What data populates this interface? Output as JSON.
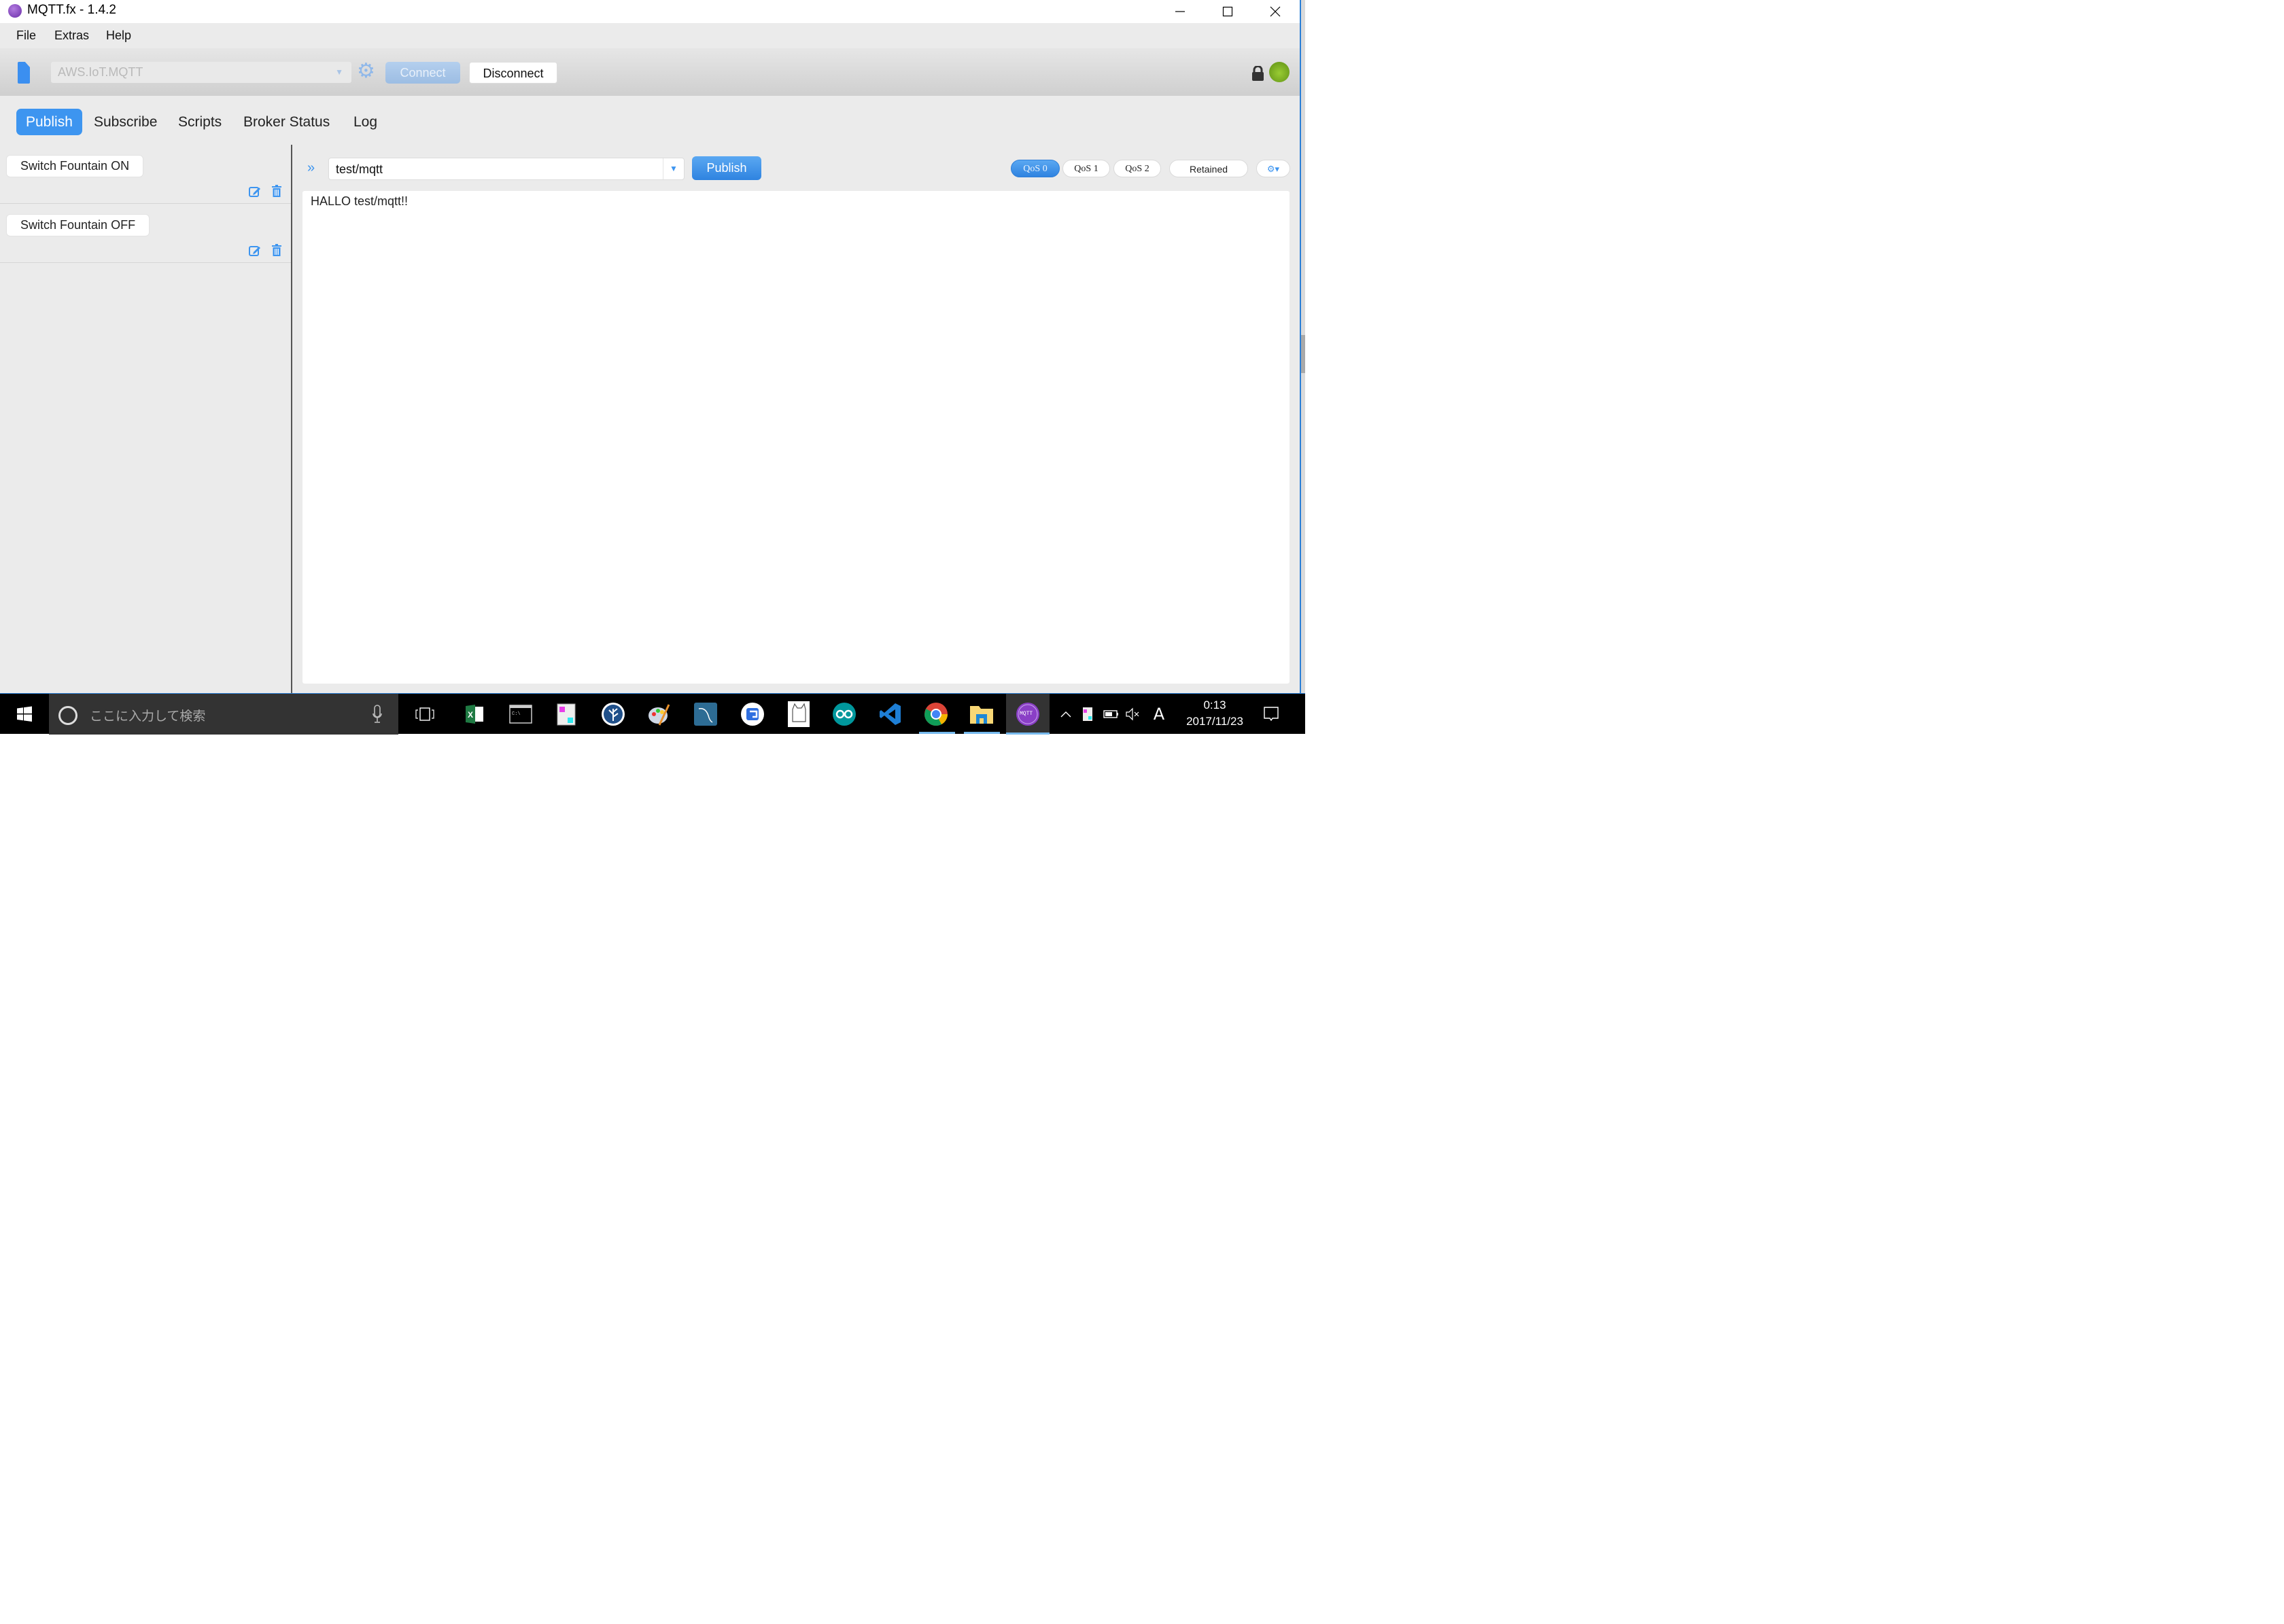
{
  "window": {
    "title": "MQTT.fx - 1.4.2",
    "controls": [
      "minimize",
      "maximize",
      "close"
    ]
  },
  "menubar": {
    "items": [
      "File",
      "Extras",
      "Help"
    ]
  },
  "connection": {
    "profile": "AWS.IoT.MQTT",
    "connect_label": "Connect",
    "disconnect_label": "Disconnect",
    "status": "connected",
    "status_color": "#7fb522",
    "secure": true
  },
  "tabs": [
    {
      "label": "Publish",
      "active": true
    },
    {
      "label": "Subscribe",
      "active": false
    },
    {
      "label": "Scripts",
      "active": false
    },
    {
      "label": "Broker Status",
      "active": false
    },
    {
      "label": "Log",
      "active": false
    }
  ],
  "publish": {
    "scripts": [
      {
        "label": "Switch Fountain ON"
      },
      {
        "label": "Switch Fountain OFF"
      }
    ],
    "topic": "test/mqtt",
    "publish_label": "Publish",
    "qos": [
      {
        "label": "QoS 0",
        "active": true
      },
      {
        "label": "QoS 1",
        "active": false
      },
      {
        "label": "QoS 2",
        "active": false
      }
    ],
    "retained_label": "Retained",
    "payload": "HALLO test/mqtt!!"
  },
  "taskbar": {
    "search_placeholder": "ここに入力して検索",
    "apps": [
      "task-view",
      "excel",
      "command-prompt",
      "notes",
      "sourcetree",
      "paint",
      "mysql-workbench",
      "google-app",
      "cat-app",
      "arduino",
      "vscode",
      "chrome",
      "file-explorer",
      "mqtt-fx"
    ],
    "time": "0:13",
    "date": "2017/11/23",
    "ime": "A",
    "accent": "#3d95f0"
  }
}
